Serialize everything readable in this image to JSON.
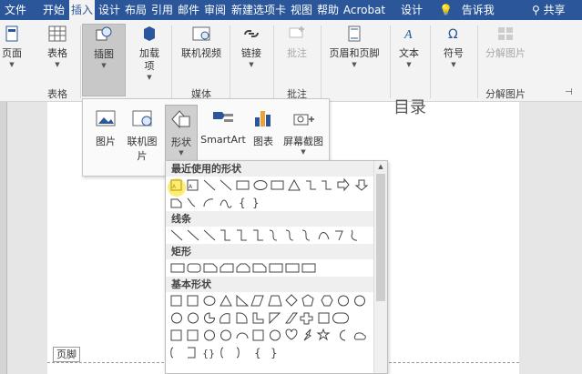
{
  "tabs": [
    {
      "label": "文件",
      "active": false
    },
    {
      "label": "开始",
      "active": false
    },
    {
      "label": "插入",
      "active": true
    },
    {
      "label": "设计",
      "active": false
    },
    {
      "label": "布局",
      "active": false
    },
    {
      "label": "引用",
      "active": false
    },
    {
      "label": "邮件",
      "active": false
    },
    {
      "label": "审阅",
      "active": false
    },
    {
      "label": "新建选项卡",
      "active": false
    },
    {
      "label": "视图",
      "active": false
    },
    {
      "label": "帮助",
      "active": false
    },
    {
      "label": "Acrobat",
      "active": false
    },
    {
      "label": "设计",
      "active": false
    }
  ],
  "tell_me": "告诉我",
  "share": "共享",
  "ribbon": {
    "pages": "页面",
    "table": "表格",
    "illustrations": "插图",
    "addins": "加载\n项",
    "online_video": "联机视频",
    "links": "链接",
    "comment": "批注",
    "header_footer": "页眉和页脚",
    "text": "文本",
    "symbols": "符号",
    "split_picture": "分解图片",
    "groups": {
      "table": "表格",
      "media": "媒体",
      "comments": "批注",
      "split": "分解图片"
    }
  },
  "illustrations_menu": {
    "picture": "图片",
    "online_picture": "联机图片",
    "shapes": "形状",
    "smartart": "SmartArt",
    "chart": "图表",
    "screenshot": "屏幕截图"
  },
  "shapes_gallery": {
    "recent": "最近使用的形状",
    "lines": "线条",
    "rectangles": "矩形",
    "basic": "基本形状"
  },
  "document": {
    "heading_fragment": "目录",
    "footer_label": "页脚"
  },
  "colors": {
    "accent": "#2b579a"
  }
}
